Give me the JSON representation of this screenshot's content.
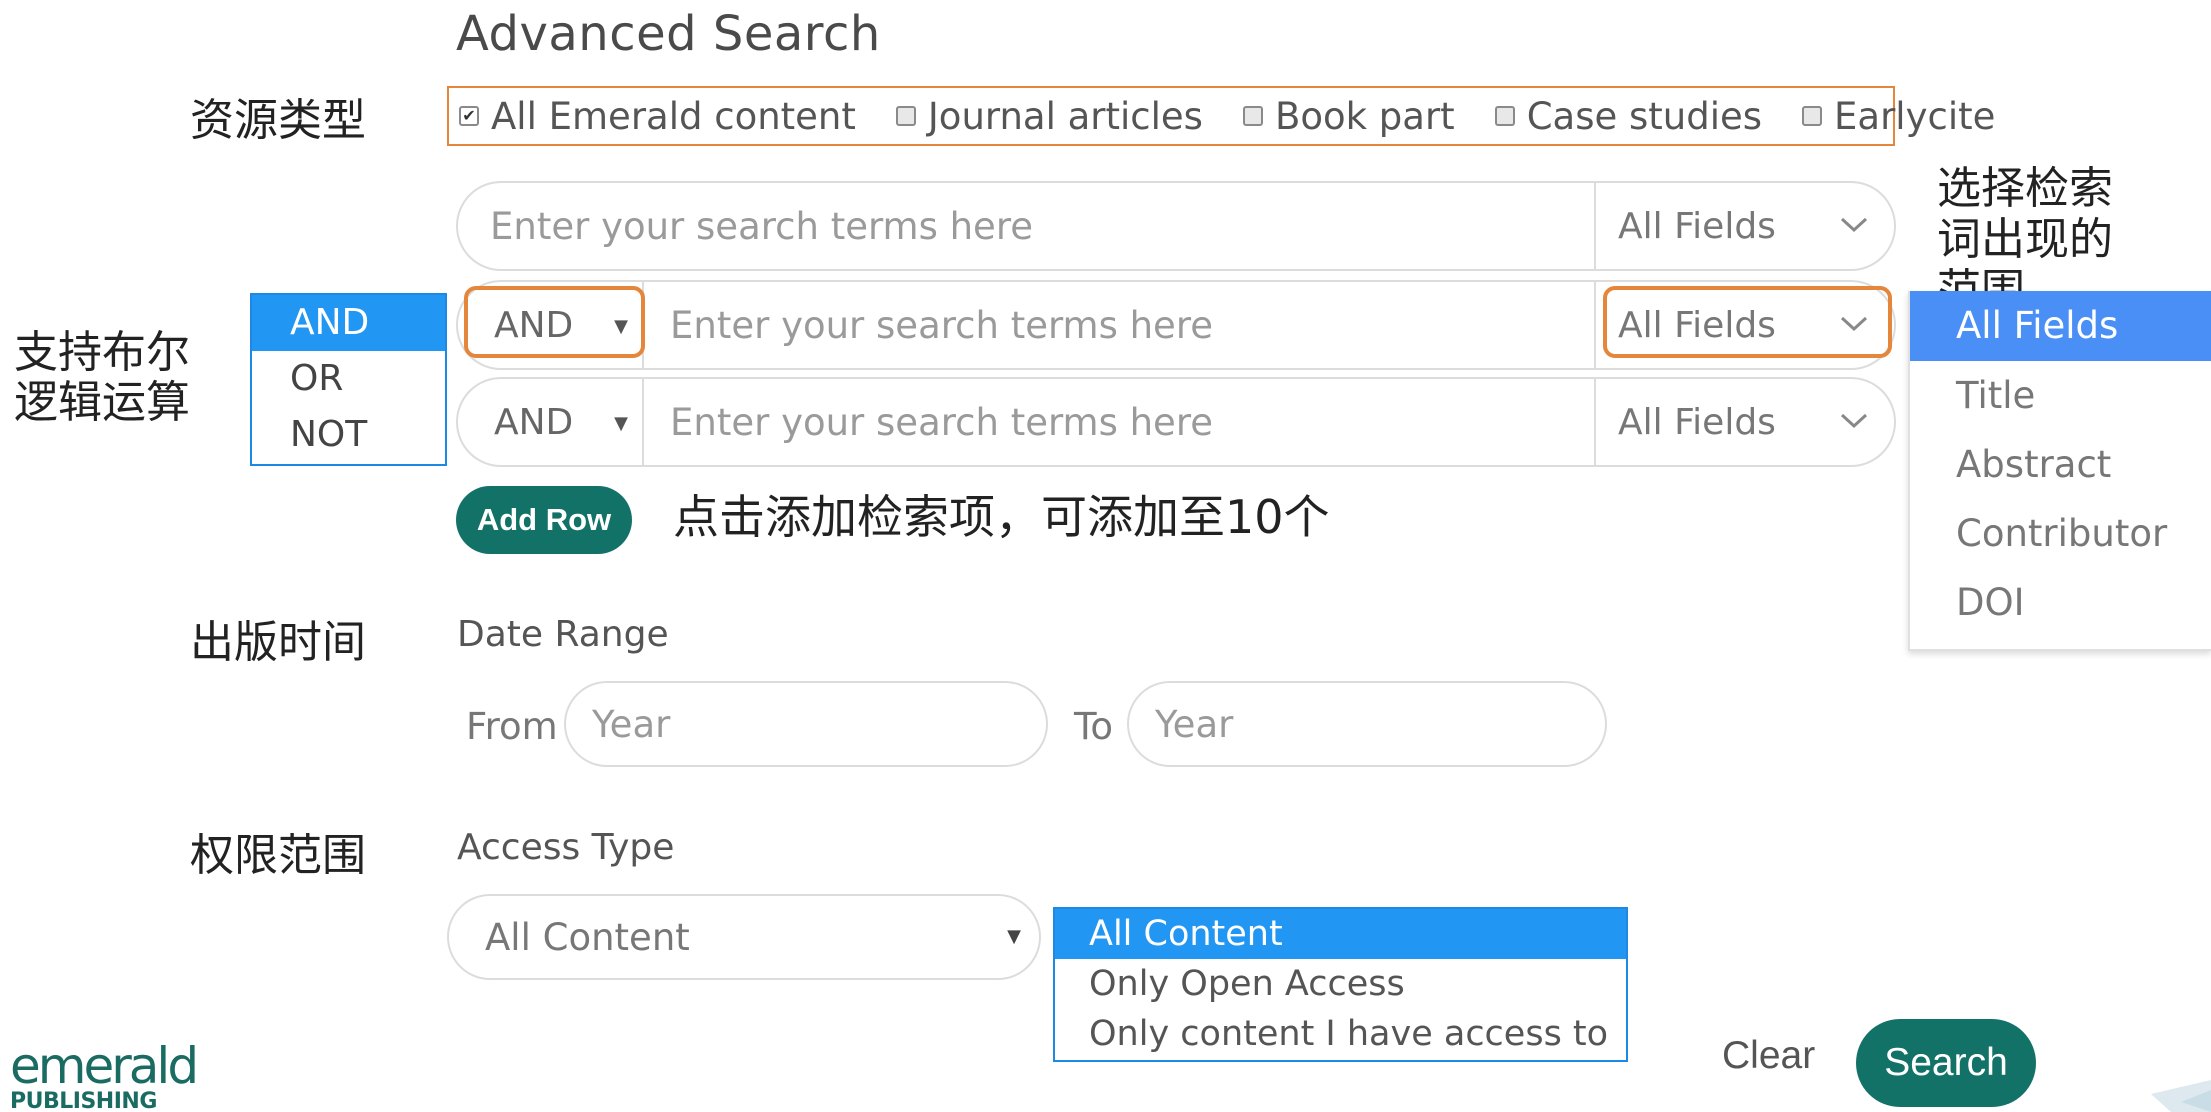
{
  "page": {
    "title": "Advanced Search"
  },
  "annotations": {
    "resource_type": "资源类型",
    "field_scope": "选择检索词出现的范围",
    "boolean_support": "支持布尔逻辑运算",
    "add_row_note": "点击添加检索项，可添加至10个",
    "pub_time": "出版时间",
    "access_scope": "权限范围"
  },
  "content_types": [
    {
      "label": "All Emerald content",
      "checked": true
    },
    {
      "label": "Journal articles",
      "checked": false
    },
    {
      "label": "Book part",
      "checked": false
    },
    {
      "label": "Case studies",
      "checked": false
    },
    {
      "label": "Earlycite",
      "checked": false
    }
  ],
  "search_rows": [
    {
      "operator": "",
      "placeholder": "Enter your search terms here",
      "field": "All Fields"
    },
    {
      "operator": "AND",
      "placeholder": "Enter your search terms here",
      "field": "All Fields"
    },
    {
      "operator": "AND",
      "placeholder": "Enter your search terms here",
      "field": "All Fields"
    }
  ],
  "boolean_options": [
    "AND",
    "OR",
    "NOT"
  ],
  "boolean_selected": "AND",
  "field_options": [
    "All Fields",
    "Title",
    "Abstract",
    "Contributor",
    "DOI"
  ],
  "field_selected": "All Fields",
  "add_row_label": "Add Row",
  "date_range": {
    "label": "Date Range",
    "from_label": "From",
    "to_label": "To",
    "from_placeholder": "Year",
    "to_placeholder": "Year"
  },
  "access_type": {
    "label": "Access Type",
    "selected": "All Content",
    "options": [
      "All Content",
      "Only Open Access",
      "Only content I have access to"
    ]
  },
  "actions": {
    "clear": "Clear",
    "search": "Search"
  },
  "logo": {
    "line1": "emerald",
    "line2": "PUBLISHING"
  },
  "colors": {
    "accent_teal": "#137268",
    "highlight_orange": "#e4873c",
    "selection_blue": "#2196f3"
  }
}
